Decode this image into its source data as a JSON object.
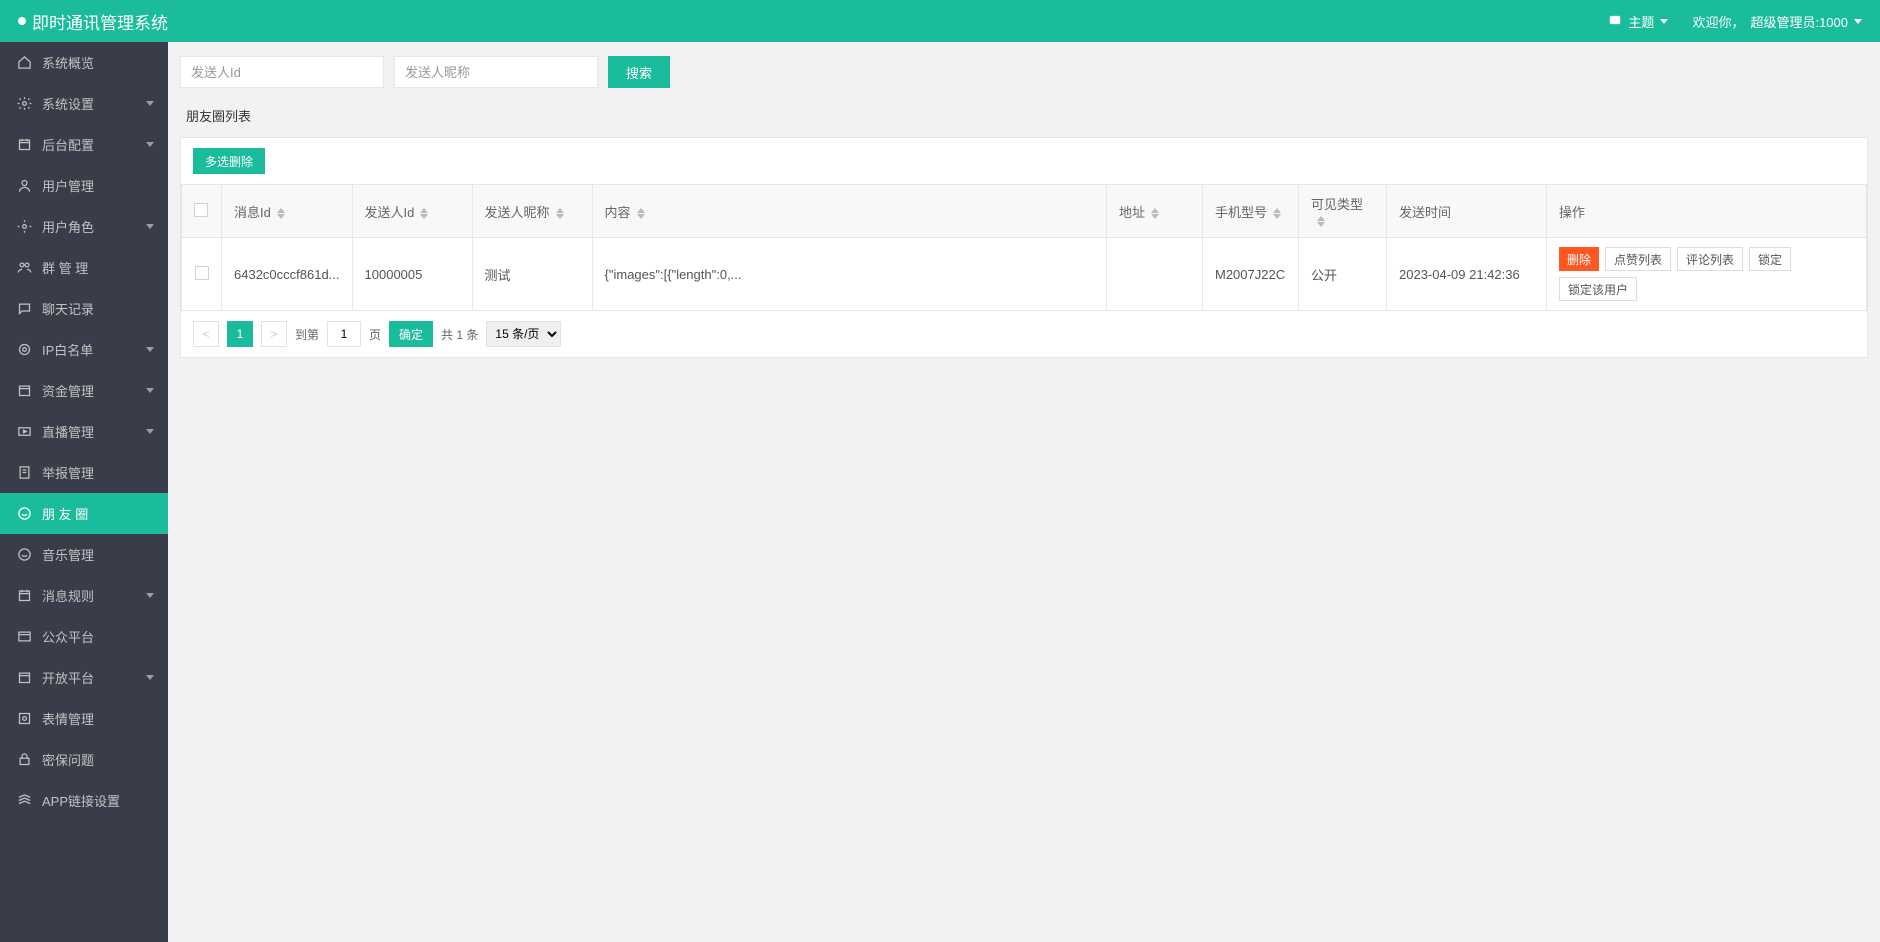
{
  "header": {
    "app_title": "即时通讯管理系统",
    "theme_label": "主题",
    "welcome_prefix": "欢迎你，",
    "welcome_user": "超级管理员:1000"
  },
  "sidebar": {
    "items": [
      {
        "label": "系统概览",
        "expandable": false
      },
      {
        "label": "系统设置",
        "expandable": true
      },
      {
        "label": "后台配置",
        "expandable": true
      },
      {
        "label": "用户管理",
        "expandable": false
      },
      {
        "label": "用户角色",
        "expandable": true
      },
      {
        "label": "群 管 理",
        "expandable": false
      },
      {
        "label": "聊天记录",
        "expandable": false
      },
      {
        "label": "IP白名单",
        "expandable": true
      },
      {
        "label": "资金管理",
        "expandable": true
      },
      {
        "label": "直播管理",
        "expandable": true
      },
      {
        "label": "举报管理",
        "expandable": false
      },
      {
        "label": "朋 友 圈",
        "expandable": false,
        "active": true
      },
      {
        "label": "音乐管理",
        "expandable": false
      },
      {
        "label": "消息规则",
        "expandable": true
      },
      {
        "label": "公众平台",
        "expandable": false
      },
      {
        "label": "开放平台",
        "expandable": true
      },
      {
        "label": "表情管理",
        "expandable": false
      },
      {
        "label": "密保问题",
        "expandable": false
      },
      {
        "label": "APP链接设置",
        "expandable": false
      }
    ]
  },
  "search": {
    "sender_id_placeholder": "发送人Id",
    "sender_nick_placeholder": "发送人昵称",
    "search_btn": "搜索"
  },
  "section": {
    "title": "朋友圈列表"
  },
  "toolbar": {
    "multi_delete": "多选删除"
  },
  "table": {
    "headers": {
      "msgId": "消息Id",
      "senderId": "发送人Id",
      "senderNick": "发送人昵称",
      "content": "内容",
      "address": "地址",
      "phoneModel": "手机型号",
      "visibleType": "可见类型",
      "sendTime": "发送时间",
      "actions": "操作"
    },
    "rows": [
      {
        "msgId": "6432c0cccf861d...",
        "senderId": "10000005",
        "senderNick": "测试",
        "content": "{\"images\":[{\"length\":0,...",
        "address": "",
        "phoneModel": "M2007J22C",
        "visibleType": "公开",
        "sendTime": "2023-04-09 21:42:36"
      }
    ],
    "action_labels": {
      "delete": "删除",
      "like_list": "点赞列表",
      "comment_list": "评论列表",
      "lock": "锁定",
      "lock_user": "锁定该用户"
    }
  },
  "pagination": {
    "current": "1",
    "goto_prefix": "到第",
    "goto_value": "1",
    "goto_suffix": "页",
    "confirm": "确定",
    "total_text": "共 1 条",
    "page_size": "15 条/页"
  }
}
